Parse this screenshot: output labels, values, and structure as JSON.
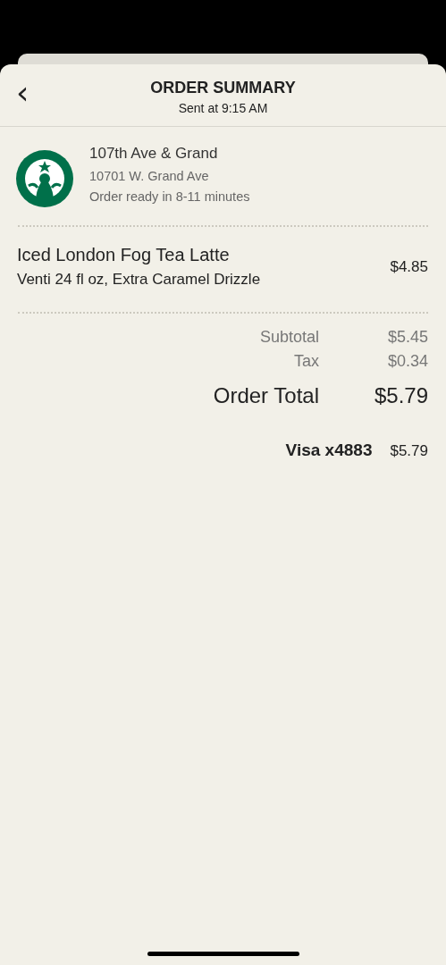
{
  "header": {
    "back": "‹",
    "title": "ORDER SUMMARY",
    "subtitle": "Sent at 9:15 AM"
  },
  "store": {
    "name": "107th Ave & Grand",
    "address": "10701 W. Grand Ave",
    "ready": "Order ready in 8-11 minutes"
  },
  "items": [
    {
      "name": "Iced London Fog Tea Latte",
      "details": "Venti 24 fl oz, Extra Caramel Drizzle",
      "price": "$4.85"
    }
  ],
  "totals": [
    {
      "kind": "minor",
      "label": "Subtotal",
      "value": "$5.45"
    },
    {
      "kind": "minor",
      "label": "Tax",
      "value": "$0.34"
    },
    {
      "kind": "total",
      "label": "Order Total",
      "value": "$5.79"
    }
  ],
  "payment": {
    "method": "Visa x4883",
    "amount": "$5.79"
  }
}
